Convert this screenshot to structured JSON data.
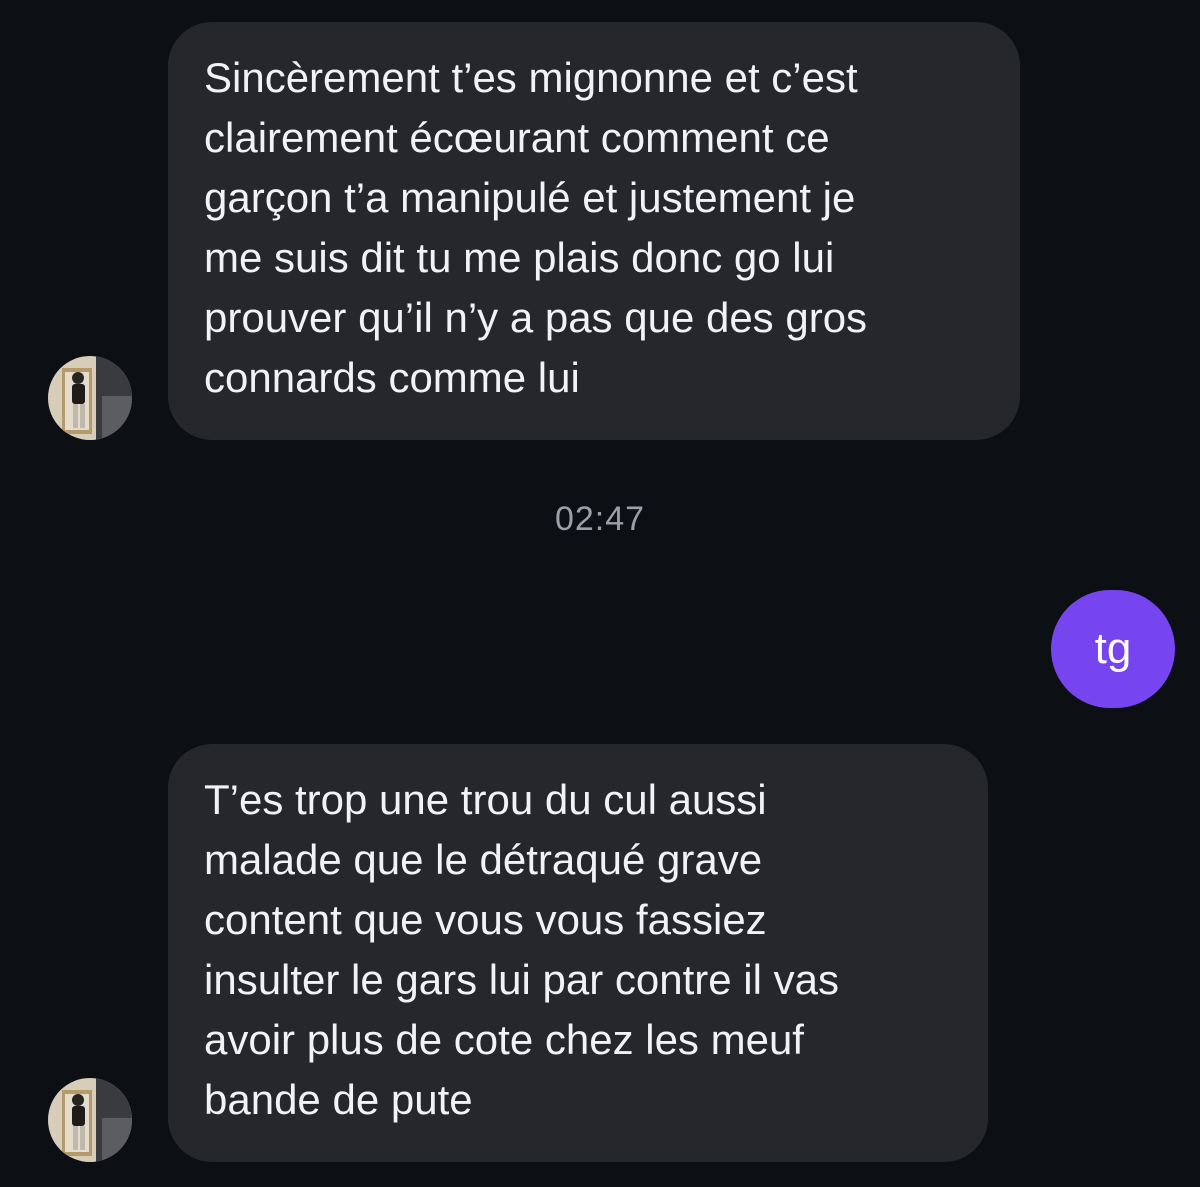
{
  "conversation": {
    "messages": [
      {
        "direction": "incoming",
        "text": "Sincèrement t’es mignonne et c’est\nclairement écœurant comment ce\ngarçon t’a manipulé et justement je\nme suis dit tu me plais donc go lui\nprouver qu’il n’y a pas que des gros\nconnards comme lui"
      },
      {
        "direction": "outgoing",
        "text": "tg"
      },
      {
        "direction": "incoming",
        "text": "T’es trop une trou du cul aussi\nmalade que le détraqué grave\ncontent que vous vous fassiez\ninsulter le gars lui par contre il vas\navoir plus de cote chez les meuf\nbande de pute"
      }
    ],
    "timestamp": "02:47"
  },
  "colors": {
    "background": "#0c0f14",
    "incoming_bubble": "#25272b",
    "outgoing_bubble": "#7645f0",
    "timestamp_text": "#9c9fa6"
  },
  "icons": {
    "avatar": "contact-avatar-photo"
  }
}
